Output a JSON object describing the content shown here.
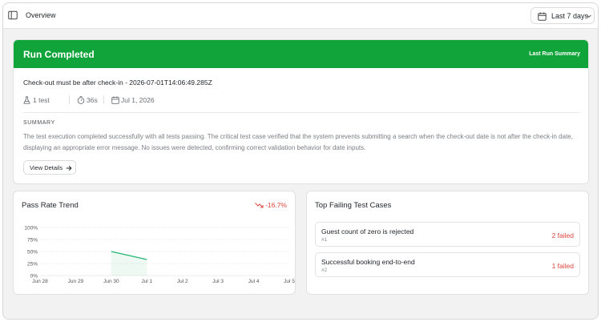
{
  "header": {
    "title": "Overview",
    "range_label": "Last 7 days"
  },
  "run": {
    "status_title": "Run Completed",
    "header_tag": "Last Run Summary",
    "name": "Check-out must be after check-in - 2026-07-01T14:06:49.285Z",
    "tests": "1 test",
    "duration": "36s",
    "date": "Jul 1, 2026",
    "summary_label": "SUMMARY",
    "summary_text": "The test execution completed successfully with all tests passing. The critical test case verified that the system prevents submitting a search when the check-out date is not after the check-in date, displaying an appropriate error message. No issues were detected, confirming correct validation behavior for date inputs.",
    "details_label": "View Details"
  },
  "trend": {
    "title": "Pass Rate Trend",
    "delta": "-16.7%"
  },
  "chart_data": {
    "type": "area",
    "categories": [
      "Jun 28",
      "Jun 29",
      "Jun 30",
      "Jul 1",
      "Jul 2",
      "Jul 3",
      "Jul 4",
      "Jul 5"
    ],
    "series": [
      {
        "values": [
          null,
          null,
          50,
          33.3,
          null,
          null,
          null,
          null
        ]
      }
    ],
    "yticks": [
      "0%",
      "25%",
      "50%",
      "75%",
      "100%"
    ],
    "ylim": [
      0,
      100
    ],
    "grid": true,
    "line_color": "#22b573"
  },
  "failing": {
    "title": "Top Failing Test Cases",
    "items": [
      {
        "name": "Guest count of zero is rejected",
        "id": "#1",
        "count": "2 failed"
      },
      {
        "name": "Successful booking end-to-end",
        "id": "#2",
        "count": "1 failed"
      }
    ]
  },
  "colors": {
    "success": "#11a43b",
    "danger": "#e0453a"
  }
}
